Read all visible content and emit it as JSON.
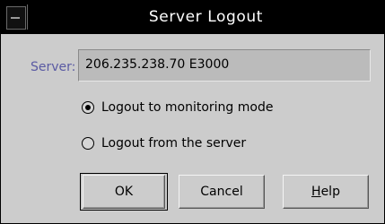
{
  "window": {
    "title": "Server Logout"
  },
  "server": {
    "label": "Server:",
    "value": "206.235.238.70 E3000"
  },
  "options": [
    {
      "label": "Logout to monitoring mode",
      "checked": true
    },
    {
      "label": "Logout from the server",
      "checked": false
    }
  ],
  "buttons": {
    "ok": "OK",
    "cancel": "Cancel",
    "help_prefix": "H",
    "help_rest": "elp"
  }
}
